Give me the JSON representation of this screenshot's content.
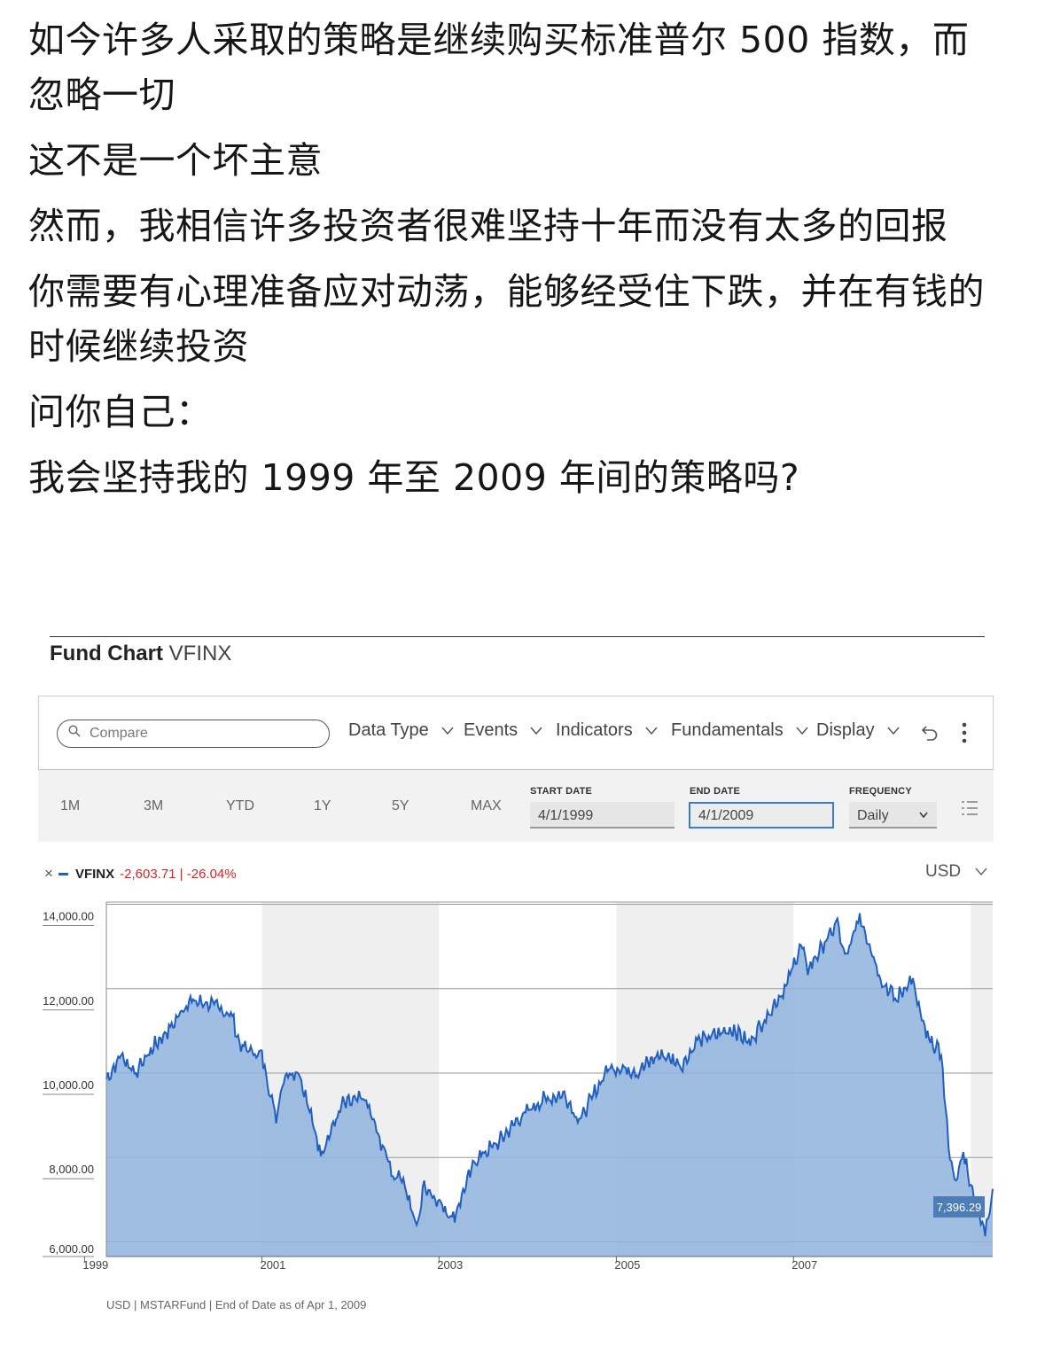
{
  "post": {
    "paragraphs": [
      "如今许多人采取的策略是继续购买标准普尔 500 指数，而忽略一切",
      "这不是一个坏主意",
      "然而，我相信许多投资者很难坚持十年而没有太多的回报",
      "你需要有心理准备应对动荡，能够经受住下跌，并在有钱的时候继续投资",
      "问你自己：",
      "我会坚持我的 1999 年至 2009 年间的策略吗?"
    ]
  },
  "widget": {
    "title_bold": "Fund Chart",
    "title_ticker": "VFINX",
    "compare_placeholder": "Compare",
    "menus": [
      "Data Type",
      "Events",
      "Indicators",
      "Fundamentals",
      "Display"
    ],
    "ranges": [
      "1M",
      "3M",
      "YTD",
      "1Y",
      "5Y",
      "MAX"
    ],
    "start_label": "START DATE",
    "start_value": "4/1/1999",
    "end_label": "END DATE",
    "end_value": "4/1/2009",
    "freq_label": "FREQUENCY",
    "freq_value": "Daily",
    "currency": "USD",
    "legend_name": "VFINX",
    "legend_change": "-2,603.71 | -26.04%",
    "footnote": "USD | MSTARFund | End of Date as of Apr 1, 2009",
    "colors": {
      "line": "#1f5fbf",
      "fill": "#8fb2dd",
      "down": "#d22222",
      "active": "#3a7bd5"
    },
    "icons": [
      "search-icon",
      "chevron-down-icon",
      "undo-icon",
      "more-vertical-icon",
      "list-icon",
      "close-icon"
    ]
  },
  "chart_data": {
    "type": "area",
    "title": "",
    "series": [
      {
        "name": "VFINX",
        "x": [
          "1999-04",
          "1999-06",
          "1999-08",
          "1999-10",
          "2000-01",
          "2000-03",
          "2000-06",
          "2000-09",
          "2000-10",
          "2001-01",
          "2001-03",
          "2001-04",
          "2001-06",
          "2001-09",
          "2001-12",
          "2002-03",
          "2002-05",
          "2002-07",
          "2002-08",
          "2002-10",
          "2002-11",
          "2003-03",
          "2003-06",
          "2003-09",
          "2003-12",
          "2004-03",
          "2004-06",
          "2004-08",
          "2004-12",
          "2005-04",
          "2005-07",
          "2005-10",
          "2005-12",
          "2006-05",
          "2006-07",
          "2006-12",
          "2007-02",
          "2007-03",
          "2007-07",
          "2007-08",
          "2007-10",
          "2008-01",
          "2008-03",
          "2008-05",
          "2008-07",
          "2008-09",
          "2008-10",
          "2008-11",
          "2008-12",
          "2009-01",
          "2009-03",
          "2009-04"
        ],
        "values": [
          10000,
          10550,
          10150,
          10700,
          11300,
          11850,
          11800,
          11500,
          10800,
          10550,
          9100,
          10100,
          10200,
          8250,
          9400,
          9550,
          8600,
          7700,
          7750,
          6450,
          7500,
          6700,
          8100,
          8500,
          9100,
          9500,
          9650,
          9000,
          10300,
          10200,
          10600,
          10350,
          10900,
          11200,
          10850,
          12200,
          13200,
          12600,
          13700,
          12800,
          13900,
          12300,
          11900,
          12400,
          11000,
          10600,
          8400,
          7500,
          8300,
          7500,
          6300,
          7400
        ]
      }
    ],
    "last_label": "7,396.29",
    "y_ticks": [
      "14,000.00",
      "12,000.00",
      "10,000.00",
      "8,000.00",
      "6,000.00"
    ],
    "x_ticks": [
      "1999",
      "2001",
      "2003",
      "2005",
      "2007"
    ],
    "ylim": [
      5800,
      14200
    ],
    "xlim": [
      "1999-04-01",
      "2009-04-01"
    ],
    "grid": true,
    "shaded_bands": [
      [
        "2001-01",
        "2003-01"
      ],
      [
        "2005-01",
        "2007-01"
      ],
      [
        "2009-01",
        "2009-04"
      ]
    ]
  }
}
